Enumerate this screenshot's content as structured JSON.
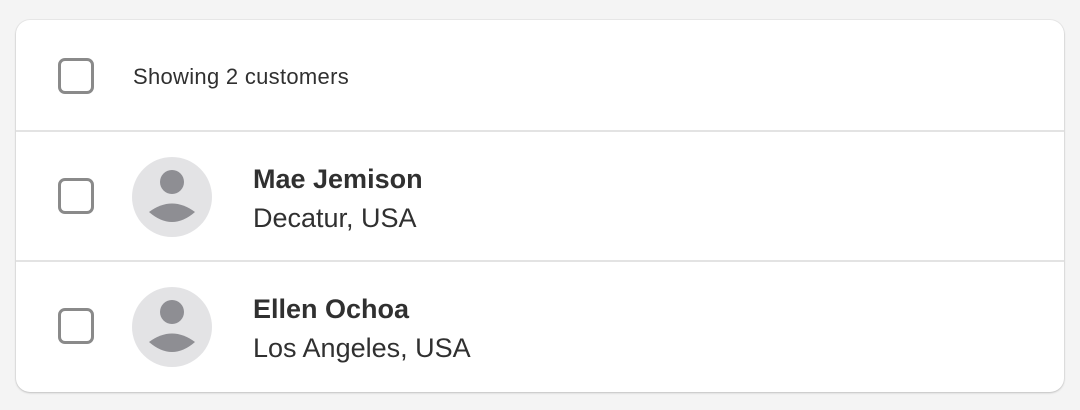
{
  "list": {
    "header_text": "Showing 2 customers",
    "customers": [
      {
        "name": "Mae Jemison",
        "location": "Decatur, USA",
        "avatar_icon": "person-placeholder-icon"
      },
      {
        "name": "Ellen Ochoa",
        "location": "Los Angeles, USA",
        "avatar_icon": "person-placeholder-icon"
      }
    ]
  },
  "colors": {
    "page_background": "#f4f4f4",
    "card_background": "#ffffff",
    "divider": "#e3e3e3",
    "checkbox_border": "#8a8a8a",
    "avatar_background": "#e3e3e5",
    "avatar_glyph": "#8e8e93",
    "text": "#303030"
  }
}
